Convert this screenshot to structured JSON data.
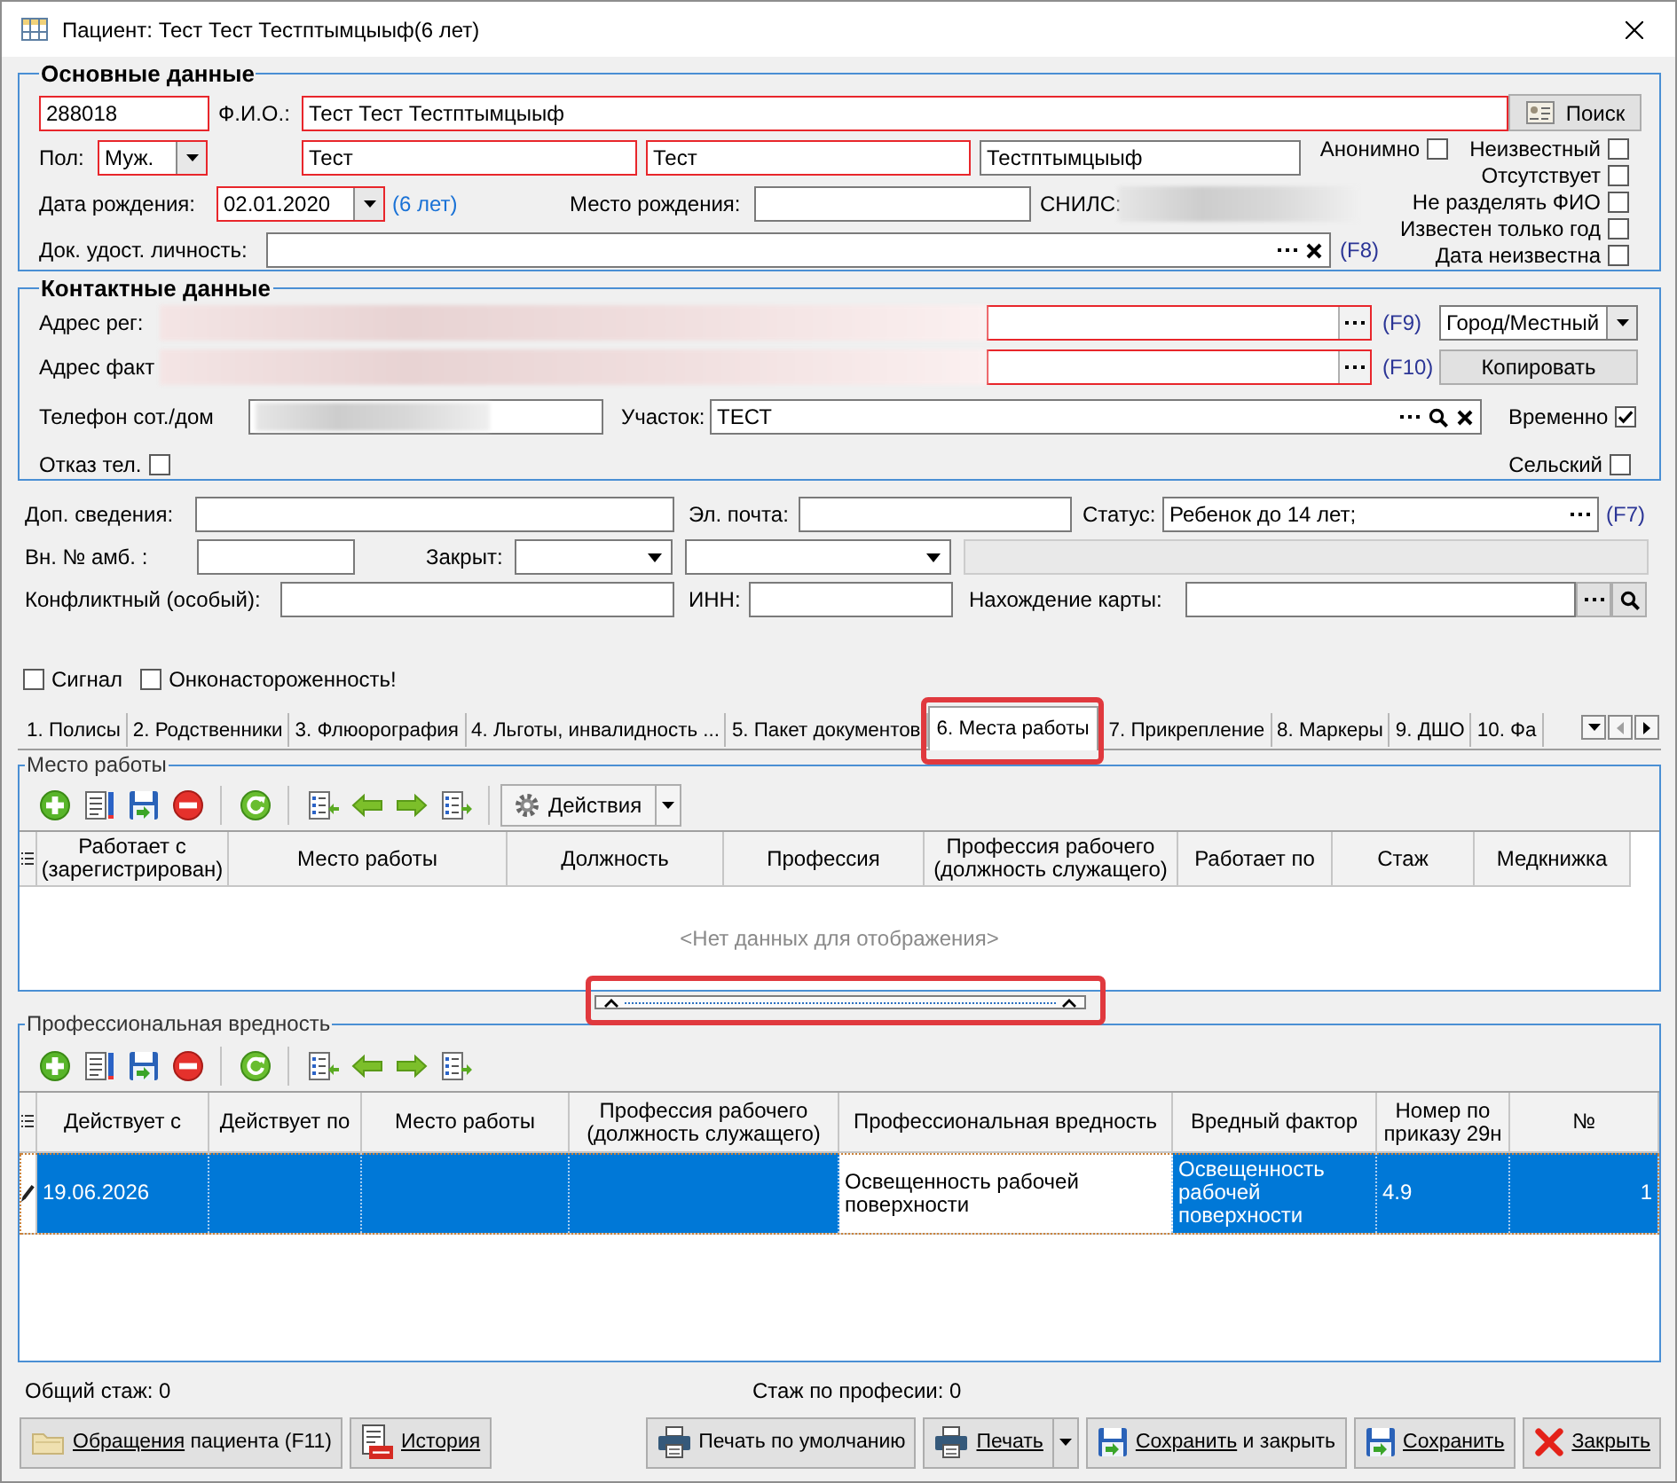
{
  "window": {
    "title": "Пациент: Тест Тест Тестптымцыыф(6 лет)"
  },
  "main_data": {
    "legend": "Основные данные",
    "card_number": {
      "value": "288018",
      "required": true
    },
    "fio": {
      "label": "Ф.И.О.:",
      "value": "Тест Тест Тестптымцыыф",
      "required": true
    },
    "search_button": "Поиск",
    "sex": {
      "label": "Пол:",
      "value": "Муж.",
      "required": true
    },
    "name_parts": [
      {
        "value": "Тест",
        "required": true
      },
      {
        "value": "Тест",
        "required": true
      },
      {
        "value": "Тестптымцыыф",
        "required": false
      }
    ],
    "birth_date": {
      "label": "Дата рождения:",
      "value": "02.01.2020",
      "required": true
    },
    "age": "(6 лет)",
    "birth_place": {
      "label": "Место рождения:"
    },
    "snils": {
      "label": "СНИЛС:"
    },
    "id_document": {
      "label": "Док. удост. личность:",
      "hotkey": "(F8)"
    },
    "flags": [
      {
        "label": "Анонимно",
        "checked": false
      },
      {
        "label": "Неизвестный",
        "checked": false
      },
      {
        "label": "Отсутствует",
        "checked": false
      },
      {
        "label": "Не разделять ФИО",
        "checked": false
      },
      {
        "label": "Известен только год",
        "checked": false
      },
      {
        "label": "Дата неизвестна",
        "checked": false
      }
    ]
  },
  "contacts": {
    "legend": "Контактные данные",
    "addresses": [
      {
        "label": "Адрес рег:",
        "required": true,
        "hotkey": "(F9)"
      },
      {
        "label": "Адрес факт",
        "required": true,
        "hotkey": "(F10)"
      }
    ],
    "locality": "Город/Местный",
    "copy_button": "Копировать",
    "phone": {
      "label": "Телефон сот./дом"
    },
    "district": {
      "label": "Участок:",
      "value": "ТЕСТ"
    },
    "temporary": {
      "label": "Временно",
      "checked": true
    },
    "phone_refusal": {
      "label": "Отказ тел.",
      "checked": false
    },
    "rural": {
      "label": "Сельский",
      "checked": false
    }
  },
  "extra": {
    "additional_info": {
      "label": "Доп. сведения:"
    },
    "email": {
      "label": "Эл. почта:"
    },
    "status": {
      "label": "Статус:",
      "value": "Ребенок до 14 лет;",
      "hotkey": "(F7)"
    },
    "outpatient_number": {
      "label": "Вн. № амб. :"
    },
    "closed": {
      "label": "Закрыт:"
    },
    "closed_note": {
      "disabled": true
    },
    "conflict": {
      "label": "Конфликтный (особый):"
    },
    "inn": {
      "label": "ИНН:"
    },
    "card_location": {
      "label": "Нахождение карты:"
    }
  },
  "alerts": [
    {
      "label": "Сигнал",
      "checked": false
    },
    {
      "label": "Онконастороженность!",
      "checked": false
    }
  ],
  "tabs": [
    {
      "label": "1. Полисы",
      "selected": false,
      "highlighted": false
    },
    {
      "label": "2. Родственники",
      "selected": false,
      "highlighted": false
    },
    {
      "label": "3. Флюорография",
      "selected": false,
      "highlighted": false
    },
    {
      "label": "4. Льготы, инвалидность ...",
      "selected": false,
      "highlighted": false
    },
    {
      "label": "5. Пакет документов",
      "selected": false,
      "highlighted": false
    },
    {
      "label": "6. Места работы",
      "selected": true,
      "highlighted": true
    },
    {
      "label": "7. Прикрепление",
      "selected": false,
      "highlighted": false
    },
    {
      "label": "8. Маркеры",
      "selected": false,
      "highlighted": false
    },
    {
      "label": "9. ДШО",
      "selected": false,
      "highlighted": false
    },
    {
      "label": "10. Фа",
      "selected": false,
      "highlighted": false
    }
  ],
  "workplaces": {
    "legend": "Место работы",
    "actions_button": "Действия",
    "columns": [
      "Работает с (зарегистрирован)",
      "Место работы",
      "Должность",
      "Профессия",
      "Профессия рабочего (должность служащего)",
      "Работает по",
      "Стаж",
      "Медкнижка"
    ],
    "empty_text": "<Нет данных для отображения>"
  },
  "splitter": {
    "highlighted": true
  },
  "hazards": {
    "legend": "Профессиональная вредность",
    "columns": [
      "Действует с",
      "Действует по",
      "Место работы",
      "Профессия рабочего (должность служащего)",
      "Профессиональная вредность",
      "Вредный фактор",
      "Номер по приказу 29н",
      "№"
    ],
    "rows": [
      {
        "selected": true,
        "editing": true,
        "cells": [
          {
            "text": "19.06.2026",
            "focused": false
          },
          {
            "focused": false
          },
          {
            "focused": false
          },
          {
            "focused": false
          },
          {
            "text": "Освещенность рабочей поверхности",
            "focused": true
          },
          {
            "text": "Освещенность рабочей поверхности",
            "focused": false
          },
          {
            "text": "4.9",
            "focused": false
          },
          {
            "text": "1",
            "focused": false
          }
        ]
      }
    ]
  },
  "summary": {
    "total_experience": "Общий стаж: 0",
    "profession_experience": "Стаж по професии: 0"
  },
  "buttons": [
    {
      "kind": "appeals",
      "underlined": "Обращения",
      "label": "пациента (F11)"
    },
    {
      "kind": "history",
      "underlined": "История"
    },
    {
      "kind": "print_default",
      "label": "Печать по умолчанию"
    },
    {
      "kind": "print",
      "underlined": "Печать"
    },
    {
      "kind": "save_close",
      "underlined": "Сохранить",
      "label": "и закрыть"
    },
    {
      "kind": "save",
      "underlined": "Сохранить"
    },
    {
      "kind": "close",
      "underlined": "Закрыть"
    }
  ]
}
